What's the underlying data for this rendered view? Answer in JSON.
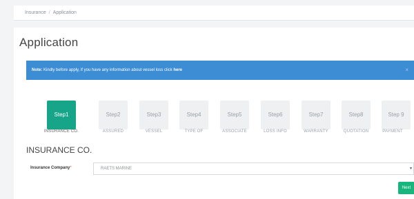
{
  "breadcrumb": {
    "root": "Insurance",
    "separator": "/",
    "current": "Application"
  },
  "page": {
    "title": "Application"
  },
  "note": {
    "label": "Note:",
    "text": "Kindly before apply, if you have any information about vessel loss click",
    "link": "here",
    "close_icon": "×"
  },
  "steps": [
    {
      "label": "Step1",
      "caption": "INSURANCE CO.",
      "active": true
    },
    {
      "label": "Step2",
      "caption": "ASSURED",
      "active": false
    },
    {
      "label": "Step3",
      "caption": "VESSEL",
      "active": false
    },
    {
      "label": "Step4",
      "caption": "TYPE OF",
      "active": false
    },
    {
      "label": "Step5",
      "caption": "ASSOCIATE",
      "active": false
    },
    {
      "label": "Step6",
      "caption": "LOSS INFO",
      "active": false
    },
    {
      "label": "Step7",
      "caption": "WARRANTY",
      "active": false
    },
    {
      "label": "Step8",
      "caption": "QUOTATION",
      "active": false
    },
    {
      "label": "Step 9",
      "caption": "PAYMENT",
      "active": false
    }
  ],
  "section": {
    "title": "INSURANCE CO."
  },
  "form": {
    "insurance_company_label": "Insurance Company",
    "required_marker": "*",
    "insurance_company_value": "RAETS MARINE",
    "chevron": "▾"
  },
  "actions": {
    "next_label": "Next"
  },
  "colors": {
    "accent_blue": "#3c8dd4",
    "active_step": "#17a589",
    "next_button": "#18b57c"
  }
}
